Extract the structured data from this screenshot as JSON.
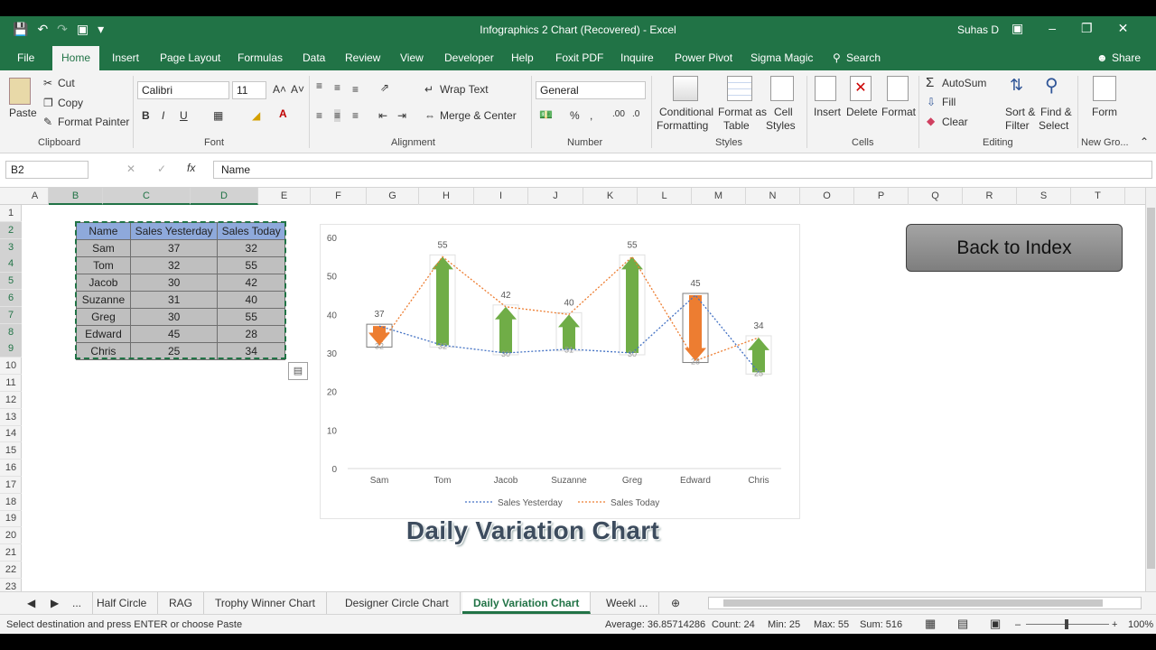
{
  "window": {
    "title": "Infographics 2 Chart (Recovered)  -  Excel",
    "user": "Suhas D"
  },
  "ribbon_tabs": [
    "File",
    "Home",
    "Insert",
    "Page Layout",
    "Formulas",
    "Data",
    "Review",
    "View",
    "Developer",
    "Help",
    "Foxit PDF",
    "Inquire",
    "Power Pivot",
    "Sigma Magic",
    "Search",
    "Share"
  ],
  "ribbon": {
    "clipboard": {
      "paste": "Paste",
      "cut": "Cut",
      "copy": "Copy",
      "format_painter": "Format Painter",
      "label": "Clipboard"
    },
    "font": {
      "name": "Calibri",
      "size": "11",
      "bold": "B",
      "italic": "I",
      "underline": "U",
      "label": "Font"
    },
    "alignment": {
      "wrap": "Wrap Text",
      "merge": "Merge & Center",
      "label": "Alignment"
    },
    "number": {
      "format": "General",
      "label": "Number"
    },
    "styles": {
      "conditional": "Conditional",
      "conditional2": "Formatting",
      "format_table": "Format as",
      "format_table2": "Table",
      "cell_styles": "Cell",
      "cell_styles2": "Styles",
      "label": "Styles"
    },
    "cells": {
      "insert": "Insert",
      "delete": "Delete",
      "format": "Format",
      "label": "Cells"
    },
    "editing": {
      "autosum": "AutoSum",
      "fill": "Fill",
      "clear": "Clear",
      "sort": "Sort &",
      "sort2": "Filter",
      "find": "Find &",
      "find2": "Select",
      "label": "Editing"
    },
    "newgroup": {
      "form": "Form",
      "label": "New Gro..."
    }
  },
  "formula_bar": {
    "name_box": "B2",
    "content": "Name"
  },
  "columns": [
    "A",
    "B",
    "C",
    "D",
    "E",
    "F",
    "G",
    "H",
    "I",
    "J",
    "K",
    "L",
    "M",
    "N",
    "O",
    "P",
    "Q",
    "R",
    "S",
    "T"
  ],
  "rows": [
    "1",
    "2",
    "3",
    "4",
    "5",
    "6",
    "7",
    "8",
    "9",
    "10",
    "11",
    "12",
    "13",
    "14",
    "15",
    "16",
    "17",
    "18",
    "19",
    "20",
    "21",
    "22",
    "23"
  ],
  "table": {
    "headers": [
      "Name",
      "Sales Yesterday",
      "Sales Today"
    ],
    "rows": [
      [
        "Sam",
        "37",
        "32"
      ],
      [
        "Tom",
        "32",
        "55"
      ],
      [
        "Jacob",
        "30",
        "42"
      ],
      [
        "Suzanne",
        "31",
        "40"
      ],
      [
        "Greg",
        "30",
        "55"
      ],
      [
        "Edward",
        "45",
        "28"
      ],
      [
        "Chris",
        "25",
        "34"
      ]
    ]
  },
  "chart_data": {
    "type": "line",
    "categories": [
      "Sam",
      "Tom",
      "Jacob",
      "Suzanne",
      "Greg",
      "Edward",
      "Chris"
    ],
    "series": [
      {
        "name": "Sales Yesterday",
        "values": [
          37,
          32,
          30,
          31,
          30,
          45,
          25
        ],
        "color": "#4472c4",
        "style": "dotted"
      },
      {
        "name": "Sales Today",
        "values": [
          32,
          55,
          42,
          40,
          55,
          28,
          34
        ],
        "color": "#ed7d31",
        "style": "dotted"
      }
    ],
    "top_labels": [
      "37",
      "55",
      "42",
      "40",
      "55",
      "45",
      "34"
    ],
    "arrow_labels": [
      "32",
      "32",
      "30",
      "31",
      "30",
      "28",
      "25"
    ],
    "yticks": [
      "0",
      "10",
      "20",
      "30",
      "40",
      "50",
      "60"
    ],
    "ylim": [
      0,
      60
    ],
    "grid": false,
    "legend": "bottom",
    "up_color": "#70ad47",
    "down_color": "#ed7d31"
  },
  "back_button": "Back to Index",
  "sheet_title": "Daily Variation Chart",
  "sheet_tabs": [
    "Half Circle",
    "RAG",
    "Trophy Winner Chart",
    "Designer Circle Chart",
    "Daily Variation Chart",
    "Weekl ..."
  ],
  "active_sheet": "Daily Variation Chart",
  "status": {
    "message": "Select destination and press ENTER or choose Paste",
    "average": "Average: 36.85714286",
    "count": "Count: 24",
    "min": "Min: 25",
    "max": "Max: 55",
    "sum": "Sum: 516",
    "zoom": "100%"
  }
}
